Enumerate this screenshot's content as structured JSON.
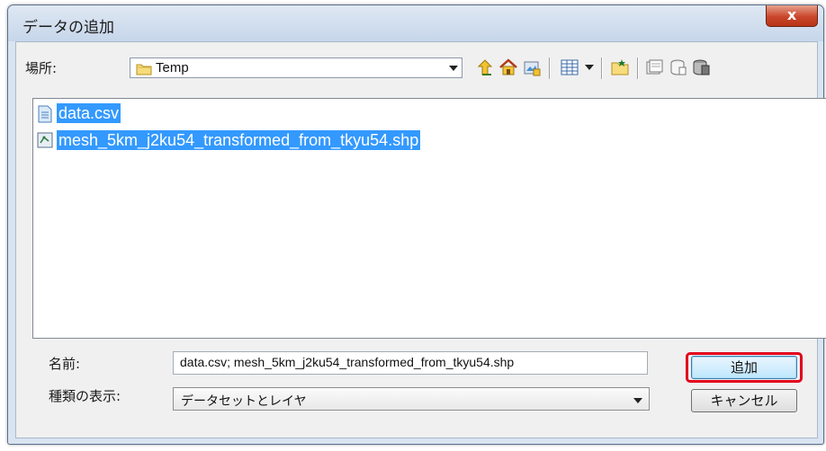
{
  "window": {
    "title": "データの追加",
    "close_glyph": "x"
  },
  "location": {
    "label": "場所:",
    "value": "Temp",
    "folder_icon": "folder-icon"
  },
  "toolbar": {
    "icons": [
      "up-one-level-icon",
      "home-icon",
      "connect-folder-icon",
      "view-options-icon",
      "new-folder-icon",
      "geodatabase-icon",
      "catalog-icon",
      "database-icon"
    ]
  },
  "files": [
    {
      "name": "data.csv",
      "icon": "table-file-icon",
      "selected": true
    },
    {
      "name": "mesh_5km_j2ku54_transformed_from_tkyu54.shp",
      "icon": "shapefile-icon",
      "selected": true
    }
  ],
  "name_field": {
    "label": "名前:",
    "value": "data.csv; mesh_5km_j2ku54_transformed_from_tkyu54.shp"
  },
  "type_field": {
    "label": "種類の表示:",
    "value": "データセットとレイヤ"
  },
  "buttons": {
    "add": "追加",
    "cancel": "キャンセル"
  },
  "colors": {
    "selection": "#3399ff",
    "highlight": "#e3001b",
    "close_button": "#c9462c"
  }
}
